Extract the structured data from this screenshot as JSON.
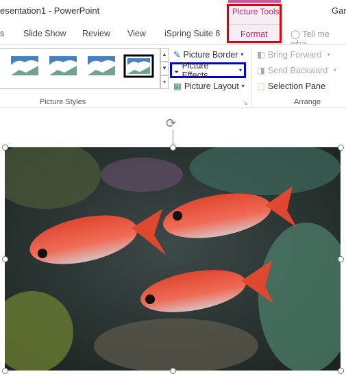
{
  "title": "esentation1 - PowerPoint",
  "user": "Garr",
  "tabs": [
    "s",
    "Slide Show",
    "Review",
    "View",
    "iSpring Suite 8"
  ],
  "context_tab": {
    "group": "Picture Tools",
    "tab": "Format",
    "color": "#c85a9a"
  },
  "tell_me": "Tell me wha",
  "picture_styles": {
    "label": "Picture Styles",
    "commands": {
      "border": "Picture Border",
      "effects": "Picture Effects",
      "layout": "Picture Layout"
    }
  },
  "arrange": {
    "label": "Arrange",
    "bring_forward": "Bring Forward",
    "send_backward": "Send Backward",
    "selection_pane": "Selection Pane"
  },
  "highlights": {
    "context_box": "#e00000",
    "effects_box": "#0000cc"
  }
}
